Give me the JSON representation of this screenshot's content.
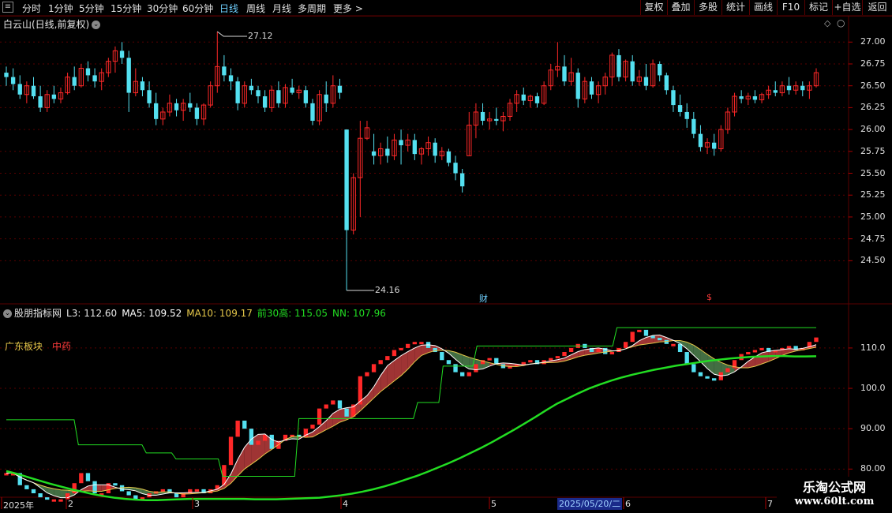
{
  "toolbar": {
    "periods": [
      "分时",
      "1分钟",
      "5分钟",
      "15分钟",
      "30分钟",
      "60分钟",
      "日线",
      "周线",
      "月线",
      "多周期",
      "更多 >"
    ],
    "active_period": "日线",
    "right_buttons": [
      "复权",
      "叠加",
      "多股",
      "统计",
      "画线",
      "F10",
      "+自选",
      "返回"
    ],
    "right_extra": "标记"
  },
  "price_pane": {
    "title": "白云山(日线,前复权)",
    "high_label": "27.12",
    "low_label": "24.16",
    "axis_ticks": [
      "27.00",
      "26.75",
      "26.50",
      "26.25",
      "26.00",
      "25.75",
      "25.50",
      "25.25",
      "25.00",
      "24.75",
      "24.50"
    ],
    "cai_marker": "财",
    "dollar_marker": "$"
  },
  "indicator_pane": {
    "name": "股朋指标网",
    "l3": "L3: 112.60",
    "ma5": "MA5: 109.52",
    "ma10": "MA10: 109.17",
    "qian30": "前30高: 115.05",
    "nn": "NN: 107.96",
    "sector": "广东板块",
    "industry": "中药",
    "axis_ticks": [
      "110.0",
      "100.0",
      "90.00",
      "80.00"
    ]
  },
  "date_axis": {
    "labels": [
      "2025年",
      "2",
      "3",
      "4",
      "5",
      "6",
      "7"
    ],
    "current": "2025/05/20/二"
  },
  "watermark": {
    "line1": "乐淘公式网",
    "line2": "www.60lt.com"
  },
  "colors": {
    "up": "#ff2828",
    "down": "#54e0f0",
    "grid": "#5a0000",
    "ma5": "#ffffff",
    "ma10": "#e6c84a",
    "nn": "#22dd22",
    "qian30": "#22dd22"
  },
  "chart_data": {
    "type": "candlestick",
    "candles_ohlc": [
      [
        26.65,
        26.72,
        26.5,
        26.6
      ],
      [
        26.6,
        26.7,
        26.45,
        26.52
      ],
      [
        26.52,
        26.62,
        26.35,
        26.4
      ],
      [
        26.4,
        26.55,
        26.3,
        26.5
      ],
      [
        26.5,
        26.6,
        26.35,
        26.38
      ],
      [
        26.38,
        26.5,
        26.2,
        26.25
      ],
      [
        26.25,
        26.45,
        26.2,
        26.4
      ],
      [
        26.4,
        26.5,
        26.3,
        26.35
      ],
      [
        26.35,
        26.48,
        26.3,
        26.42
      ],
      [
        26.42,
        26.65,
        26.4,
        26.6
      ],
      [
        26.6,
        26.72,
        26.45,
        26.5
      ],
      [
        26.5,
        26.75,
        26.48,
        26.7
      ],
      [
        26.7,
        26.78,
        26.55,
        26.62
      ],
      [
        26.62,
        26.7,
        26.48,
        26.55
      ],
      [
        26.55,
        26.7,
        26.45,
        26.65
      ],
      [
        26.65,
        26.82,
        26.6,
        26.78
      ],
      [
        26.78,
        26.95,
        26.65,
        26.9
      ],
      [
        26.9,
        27.0,
        26.75,
        26.82
      ],
      [
        26.82,
        26.9,
        26.2,
        26.42
      ],
      [
        26.42,
        26.7,
        26.38,
        26.55
      ],
      [
        26.55,
        26.6,
        26.38,
        26.45
      ],
      [
        26.45,
        26.55,
        26.25,
        26.3
      ],
      [
        26.3,
        26.42,
        26.05,
        26.12
      ],
      [
        26.12,
        26.25,
        26.05,
        26.2
      ],
      [
        26.2,
        26.4,
        26.15,
        26.3
      ],
      [
        26.3,
        26.35,
        26.15,
        26.22
      ],
      [
        26.22,
        26.35,
        26.1,
        26.3
      ],
      [
        26.3,
        26.42,
        26.2,
        26.25
      ],
      [
        26.25,
        26.3,
        26.05,
        26.12
      ],
      [
        26.12,
        26.3,
        26.05,
        26.28
      ],
      [
        26.28,
        26.55,
        26.25,
        26.5
      ],
      [
        26.5,
        27.12,
        26.42,
        26.72
      ],
      [
        26.72,
        26.85,
        26.55,
        26.62
      ],
      [
        26.62,
        26.7,
        26.45,
        26.55
      ],
      [
        26.55,
        26.6,
        26.22,
        26.3
      ],
      [
        26.3,
        26.55,
        26.25,
        26.5
      ],
      [
        26.5,
        26.58,
        26.4,
        26.45
      ],
      [
        26.45,
        26.5,
        26.3,
        26.38
      ],
      [
        26.38,
        26.45,
        26.2,
        26.25
      ],
      [
        26.25,
        26.5,
        26.2,
        26.45
      ],
      [
        26.45,
        26.55,
        26.25,
        26.3
      ],
      [
        26.3,
        26.52,
        26.25,
        26.48
      ],
      [
        26.48,
        26.58,
        26.4,
        26.42
      ],
      [
        26.42,
        26.5,
        26.35,
        26.45
      ],
      [
        26.45,
        26.5,
        26.25,
        26.3
      ],
      [
        26.3,
        26.35,
        26.05,
        26.1
      ],
      [
        26.1,
        26.45,
        26.05,
        26.4
      ],
      [
        26.4,
        26.55,
        26.2,
        26.3
      ],
      [
        26.3,
        26.62,
        26.25,
        26.5
      ],
      [
        26.5,
        26.58,
        26.35,
        26.42
      ],
      [
        26.0,
        26.0,
        24.16,
        24.85
      ],
      [
        24.85,
        25.5,
        24.8,
        25.45
      ],
      [
        25.45,
        26.1,
        25.0,
        25.9
      ],
      [
        25.9,
        26.1,
        25.88,
        26.02
      ],
      [
        25.75,
        25.95,
        25.6,
        25.7
      ],
      [
        25.7,
        25.85,
        25.6,
        25.78
      ],
      [
        25.78,
        25.92,
        25.62,
        25.7
      ],
      [
        25.7,
        25.95,
        25.65,
        25.88
      ],
      [
        25.88,
        26.0,
        25.6,
        25.82
      ],
      [
        25.82,
        25.95,
        25.75,
        25.88
      ],
      [
        25.88,
        25.95,
        25.65,
        25.72
      ],
      [
        25.72,
        25.8,
        25.6,
        25.78
      ],
      [
        25.78,
        25.92,
        25.7,
        25.85
      ],
      [
        25.85,
        25.9,
        25.62,
        25.7
      ],
      [
        25.7,
        25.8,
        25.65,
        25.75
      ],
      [
        25.75,
        25.78,
        25.58,
        25.62
      ],
      [
        25.62,
        25.7,
        25.42,
        25.5
      ],
      [
        25.5,
        25.55,
        25.28,
        25.35
      ],
      [
        25.7,
        26.2,
        25.7,
        26.05
      ],
      [
        26.05,
        26.3,
        25.9,
        26.2
      ],
      [
        26.2,
        26.3,
        26.05,
        26.1
      ],
      [
        26.1,
        26.2,
        26.0,
        26.12
      ],
      [
        26.12,
        26.25,
        26.05,
        26.1
      ],
      [
        26.1,
        26.2,
        25.98,
        26.15
      ],
      [
        26.15,
        26.35,
        26.1,
        26.3
      ],
      [
        26.3,
        26.45,
        26.2,
        26.4
      ],
      [
        26.4,
        26.48,
        26.28,
        26.33
      ],
      [
        26.33,
        26.4,
        26.25,
        26.38
      ],
      [
        26.38,
        26.42,
        26.25,
        26.3
      ],
      [
        26.3,
        26.55,
        26.28,
        26.5
      ],
      [
        26.5,
        26.75,
        26.45,
        26.68
      ],
      [
        26.68,
        27.0,
        26.6,
        26.72
      ],
      [
        26.72,
        26.85,
        26.5,
        26.55
      ],
      [
        26.55,
        26.82,
        26.5,
        26.65
      ],
      [
        26.65,
        26.7,
        26.25,
        26.35
      ],
      [
        26.35,
        26.6,
        26.3,
        26.55
      ],
      [
        26.55,
        26.6,
        26.35,
        26.4
      ],
      [
        26.4,
        26.55,
        26.3,
        26.5
      ],
      [
        26.5,
        26.65,
        26.4,
        26.6
      ],
      [
        26.6,
        26.88,
        26.5,
        26.85
      ],
      [
        26.85,
        26.92,
        26.55,
        26.6
      ],
      [
        26.6,
        26.8,
        26.55,
        26.78
      ],
      [
        26.78,
        26.85,
        26.5,
        26.55
      ],
      [
        26.55,
        26.68,
        26.5,
        26.6
      ],
      [
        26.6,
        26.75,
        26.45,
        26.5
      ],
      [
        26.5,
        26.8,
        26.48,
        26.75
      ],
      [
        26.75,
        26.78,
        26.55,
        26.62
      ],
      [
        26.62,
        26.65,
        26.4,
        26.45
      ],
      [
        26.45,
        26.5,
        26.2,
        26.28
      ],
      [
        26.28,
        26.4,
        26.15,
        26.2
      ],
      [
        26.2,
        26.3,
        26.02,
        26.12
      ],
      [
        26.12,
        26.2,
        25.9,
        25.95
      ],
      [
        25.95,
        26.05,
        25.75,
        25.8
      ],
      [
        25.8,
        25.9,
        25.72,
        25.85
      ],
      [
        25.85,
        25.95,
        25.7,
        25.78
      ],
      [
        25.78,
        26.05,
        25.75,
        26.0
      ],
      [
        26.0,
        26.25,
        25.95,
        26.2
      ],
      [
        26.2,
        26.42,
        26.15,
        26.38
      ],
      [
        26.38,
        26.45,
        26.3,
        26.35
      ],
      [
        26.35,
        26.42,
        26.28,
        26.38
      ],
      [
        26.38,
        26.45,
        26.3,
        26.34
      ],
      [
        26.34,
        26.42,
        26.3,
        26.4
      ],
      [
        26.4,
        26.5,
        26.35,
        26.45
      ],
      [
        26.45,
        26.55,
        26.38,
        26.42
      ],
      [
        26.42,
        26.55,
        26.38,
        26.5
      ],
      [
        26.5,
        26.6,
        26.4,
        26.45
      ],
      [
        26.45,
        26.55,
        26.4,
        26.5
      ],
      [
        26.5,
        26.55,
        26.38,
        26.45
      ],
      [
        26.45,
        26.55,
        26.35,
        26.5
      ],
      [
        26.5,
        26.7,
        26.48,
        26.65
      ]
    ],
    "indicator": {
      "nn": [
        79.5,
        78.8,
        78.0,
        77.2,
        76.4,
        75.7,
        75.0,
        74.4,
        73.8,
        73.3,
        72.9,
        72.6,
        72.4,
        72.3,
        72.3,
        72.4,
        72.5,
        72.6,
        72.6,
        72.6,
        72.6,
        72.6,
        72.6,
        72.5,
        72.5,
        72.5,
        72.6,
        72.7,
        72.8,
        72.9,
        73.2,
        73.5,
        73.9,
        74.4,
        75.0,
        75.7,
        76.5,
        77.4,
        78.3,
        79.3,
        80.4,
        81.5,
        82.7,
        84.0,
        85.3,
        86.7,
        88.2,
        89.7,
        91.3,
        92.9,
        94.6,
        96.2,
        97.5,
        98.8,
        100.0,
        101.0,
        101.9,
        102.7,
        103.4,
        104.0,
        104.6,
        105.1,
        105.6,
        106.0,
        106.4,
        106.8,
        107.1,
        107.4,
        107.6,
        107.8,
        107.9,
        108.0,
        108.0,
        107.9,
        107.9,
        107.96
      ],
      "qian30": [
        92.2,
        92.2,
        92.2,
        92.2,
        92.2,
        92.2,
        92.2,
        92.2,
        92.2,
        92.2,
        92.2,
        92.2,
        92.2,
        92.2,
        92.2,
        92.2,
        92.2,
        86.0,
        86.0,
        86.0,
        86.0,
        86.0,
        86.0,
        86.0,
        86.0,
        86.0,
        86.0,
        86.0,
        86.0,
        86.0,
        86.0,
        86.0,
        86.0,
        84.0,
        84.0,
        84.0,
        84.0,
        84.0,
        84.0,
        84.0,
        82.5,
        82.5,
        82.5,
        82.5,
        82.5,
        82.5,
        82.5,
        82.5,
        82.5,
        82.5,
        82.5,
        78.2,
        78.2,
        78.2,
        78.2,
        78.2,
        78.2,
        78.2,
        78.2,
        78.2,
        78.2,
        78.2,
        78.2,
        78.2,
        78.2,
        78.2,
        78.2,
        78.2,
        78.2,
        92.5,
        92.5,
        92.5,
        92.5,
        92.5,
        92.5,
        92.5,
        92.5,
        92.5,
        92.5,
        92.5,
        92.5,
        92.5,
        92.5,
        92.5,
        92.5,
        92.5,
        92.5,
        92.5,
        92.5,
        92.5,
        92.5,
        92.5,
        92.5,
        92.5,
        92.5,
        92.5,
        92.5,
        96.5,
        96.5,
        96.5,
        96.5,
        96.5,
        96.5,
        105.5,
        105.5,
        105.5,
        105.5,
        105.5,
        105.5,
        105.5,
        105.5,
        110.5,
        110.5,
        110.5,
        110.5,
        110.5,
        110.5,
        110.5,
        110.5,
        110.5,
        110.5,
        110.5,
        110.5,
        110.5,
        110.5,
        110.5,
        110.5,
        110.5,
        110.5,
        110.5,
        110.5,
        110.5,
        110.5,
        110.5,
        110.5,
        110.5,
        110.5,
        110.5,
        110.5,
        110.5,
        110.5,
        110.5,
        110.5,
        110.5,
        115.05,
        115.05,
        115.05,
        115.05,
        115.05,
        115.05,
        115.05,
        115.05,
        115.05,
        115.05,
        115.05,
        115.05,
        115.05,
        115.05,
        115.05,
        115.05,
        115.05,
        115.05,
        115.05,
        115.05,
        115.05,
        115.05,
        115.05,
        115.05,
        115.05,
        115.05,
        115.05,
        115.05,
        115.05,
        115.05,
        115.05,
        115.05,
        115.05,
        115.05,
        115.05,
        115.05,
        115.05,
        115.05,
        115.05,
        115.05,
        115.05,
        115.05,
        115.05,
        115.05,
        115.05,
        115.05,
        115.05,
        115.05
      ]
    },
    "price_ylim": [
      24.16,
      27.12
    ],
    "indicator_ylim": [
      74,
      118
    ]
  }
}
